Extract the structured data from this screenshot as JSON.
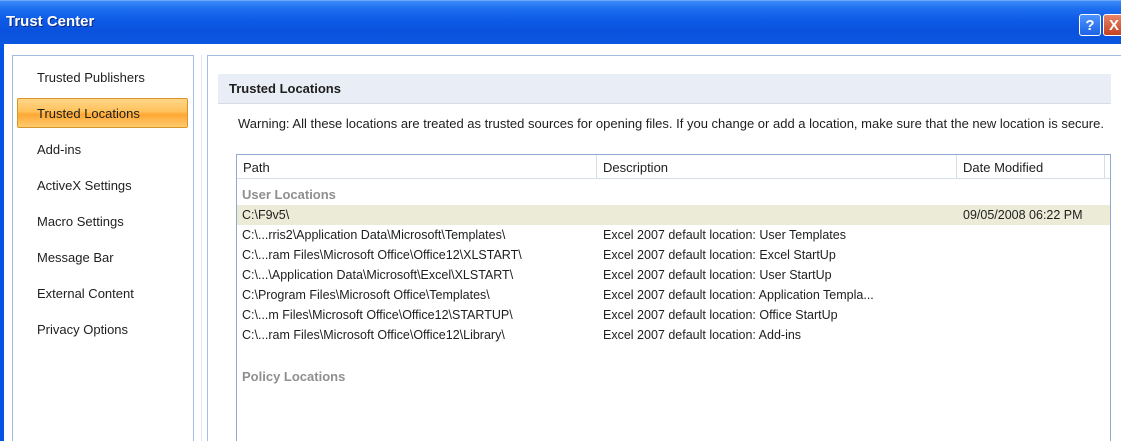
{
  "window": {
    "title": "Trust Center",
    "help_label": "?",
    "close_label": "X"
  },
  "sidebar": {
    "items": [
      {
        "label": "Trusted Publishers"
      },
      {
        "label": "Trusted Locations"
      },
      {
        "label": "Add-ins"
      },
      {
        "label": "ActiveX Settings"
      },
      {
        "label": "Macro Settings"
      },
      {
        "label": "Message Bar"
      },
      {
        "label": "External Content"
      },
      {
        "label": "Privacy Options"
      }
    ],
    "active": "Trusted Locations"
  },
  "main": {
    "section_title": "Trusted Locations",
    "warning": "Warning: All these locations are treated as trusted sources for opening files.  If you change or add a location, make sure that the new location is secure.",
    "columns": {
      "path": "Path",
      "description": "Description",
      "date": "Date Modified"
    },
    "user_group_label": "User Locations",
    "user_locations": [
      {
        "path": "C:\\F9v5\\",
        "description": "",
        "date": "09/05/2008 06:22 PM"
      },
      {
        "path": "C:\\...rris2\\Application Data\\Microsoft\\Templates\\",
        "description": "Excel 2007 default location: User Templates",
        "date": ""
      },
      {
        "path": "C:\\...ram Files\\Microsoft Office\\Office12\\XLSTART\\",
        "description": "Excel 2007 default location: Excel StartUp",
        "date": ""
      },
      {
        "path": "C:\\...\\Application Data\\Microsoft\\Excel\\XLSTART\\",
        "description": "Excel 2007 default location: User StartUp",
        "date": ""
      },
      {
        "path": "C:\\Program Files\\Microsoft Office\\Templates\\",
        "description": "Excel 2007 default location: Application Templa...",
        "date": ""
      },
      {
        "path": "C:\\...m Files\\Microsoft Office\\Office12\\STARTUP\\",
        "description": "Excel 2007 default location: Office StartUp",
        "date": ""
      },
      {
        "path": "C:\\...ram Files\\Microsoft Office\\Office12\\Library\\",
        "description": "Excel 2007 default location: Add-ins",
        "date": ""
      }
    ],
    "policy_group_label": "Policy Locations"
  },
  "colors": {
    "titlebar": "#0a52de",
    "active_item": "#ffc15a",
    "selected_row": "#ebebd8",
    "group_label": "#8f8f8f"
  }
}
